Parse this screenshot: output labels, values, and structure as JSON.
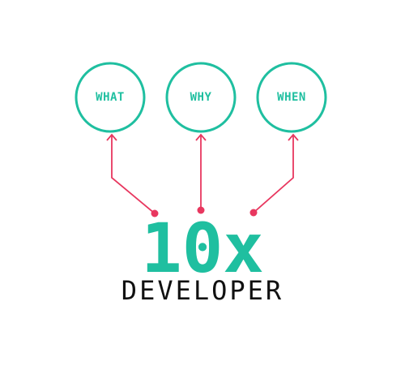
{
  "colors": {
    "accent": "#1fbfa0",
    "connector": "#e8375f",
    "text": "#111111",
    "background": "#ffffff"
  },
  "nodes": [
    {
      "label": "WHAT"
    },
    {
      "label": "WHY"
    },
    {
      "label": "WHEN"
    }
  ],
  "title": "10x",
  "subtitle": "DEVELOPER"
}
